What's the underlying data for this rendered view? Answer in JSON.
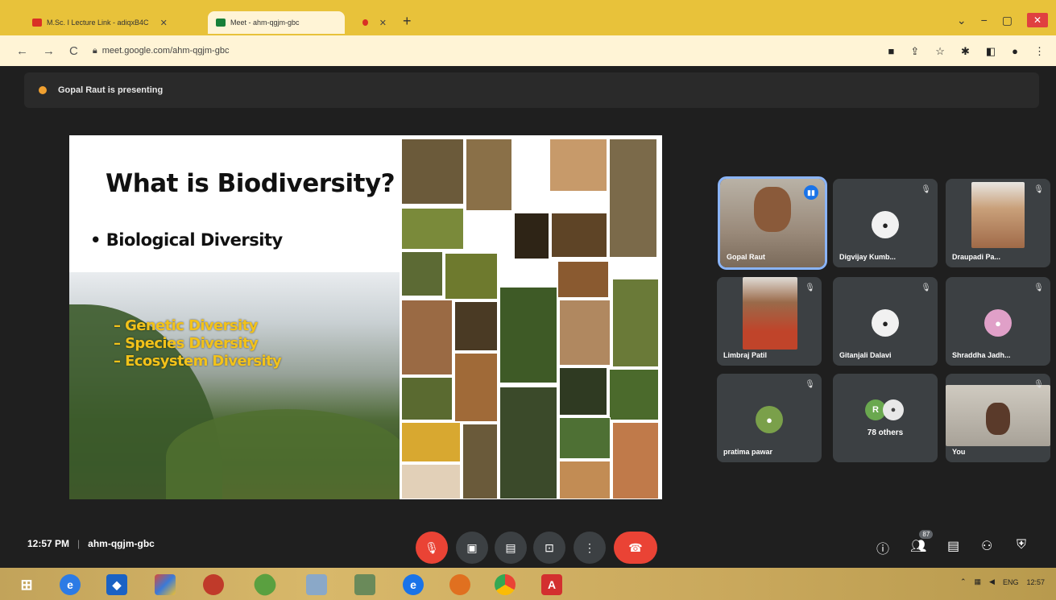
{
  "browser": {
    "tabs": [
      {
        "label": "M.Sc. I Lecture Link - adiqxB4C",
        "favicon_color": "#d93025"
      },
      {
        "label": "Meet - ahm-qgjm-gbc",
        "favicon_color": "#188038"
      },
      {
        "label": "",
        "favicon_color": "#d93025"
      }
    ],
    "new_tab": "+",
    "url": "meet.google.com/ahm-qgjm-gbc"
  },
  "meet": {
    "presenting_text": "Gopal Raut is presenting",
    "slide": {
      "title": "What is Biodiversity?",
      "bullet": "• Biological Diversity",
      "sub_bullets": [
        "– Genetic Diversity",
        "– Species Diversity",
        "– Ecosystem Diversity"
      ]
    },
    "participants": [
      {
        "name": "Gopal Raut",
        "type": "video",
        "speaking": true
      },
      {
        "name": "Digvijay Kumb...",
        "type": "avatar",
        "muted": true
      },
      {
        "name": "Draupadi Pa...",
        "type": "video",
        "muted": true
      },
      {
        "name": "Limbraj Patil",
        "type": "video",
        "muted": true
      },
      {
        "name": "Gitanjali Dalavi",
        "type": "avatar",
        "muted": true
      },
      {
        "name": "Shraddha Jadh...",
        "type": "avatar",
        "muted": true
      },
      {
        "name": "pratima pawar",
        "type": "avatar",
        "muted": true
      },
      {
        "name": "78 others",
        "type": "others"
      },
      {
        "name": "You",
        "type": "video",
        "muted": true
      }
    ],
    "others_initial": "R",
    "time": "12:57 PM",
    "meeting_code": "ahm-qgjm-gbc",
    "participant_count": "87",
    "colors": {
      "end_call": "#ea4335",
      "speaking": "#1a73e8",
      "highlight": "#f2c21a"
    }
  },
  "taskbar": {
    "tray_lang": "ENG",
    "tray_time": "12:57"
  }
}
